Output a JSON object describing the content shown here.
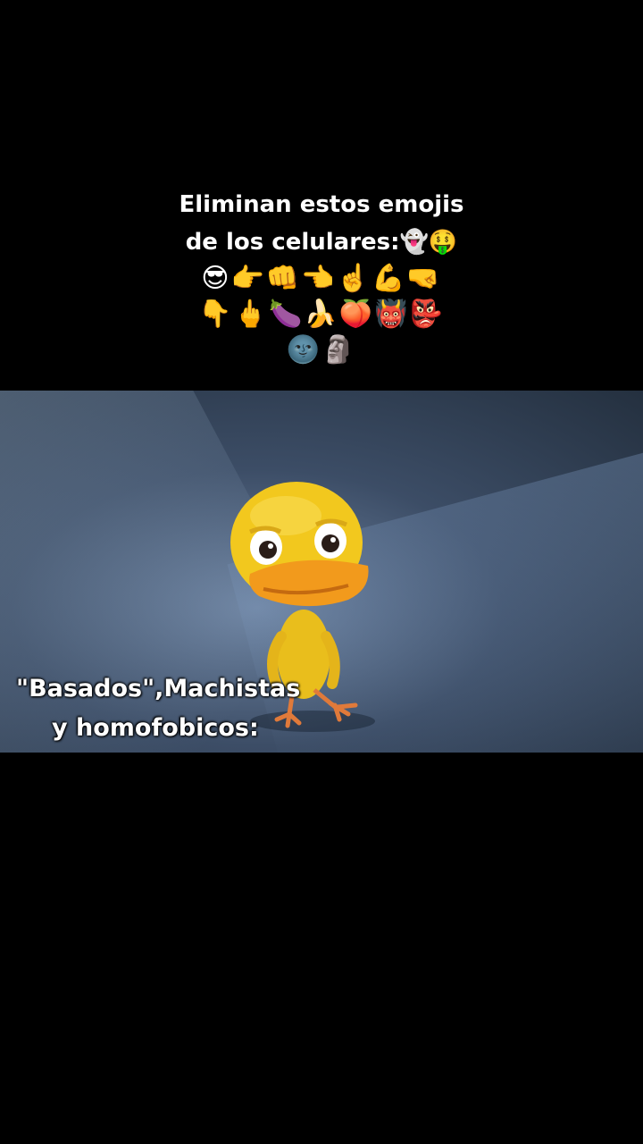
{
  "caption": {
    "line1": "Eliminan estos emojis",
    "line2": "de los celulares:👻🤑",
    "emoji_row1": "😎👉👊👈☝️💪🤜",
    "emoji_row2": "👇🖕🍆🍌🍑👹👺",
    "emoji_row3": "🌚🗿"
  },
  "video": {
    "subtitle_line1": "\"Basados\",Machistas",
    "subtitle_line2": "y homofobicos:",
    "character_icon": "yellow-duck-character"
  },
  "colors": {
    "background": "#000000",
    "text": "#ffffff",
    "duck_yellow": "#f2c81e",
    "duck_beak": "#f0941a"
  }
}
